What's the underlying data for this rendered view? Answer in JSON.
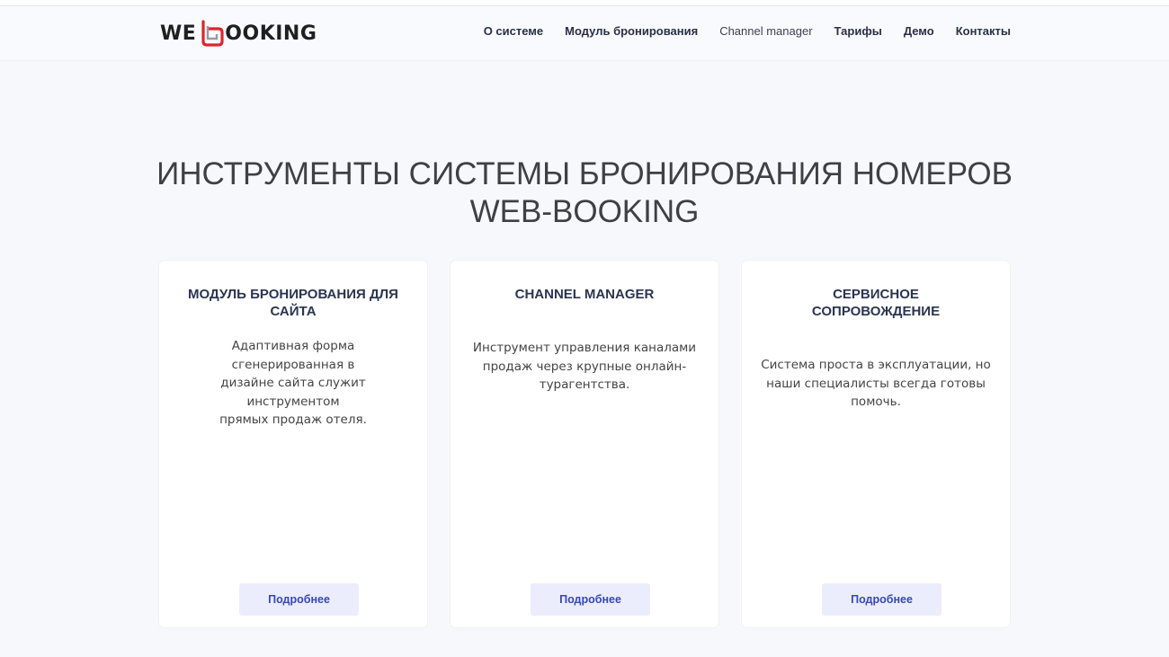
{
  "brand": {
    "logo_left": "WE",
    "logo_right": "OOKING",
    "accent_color": "#d8282e"
  },
  "nav": {
    "items": [
      {
        "label": "О системе"
      },
      {
        "label": "Модуль бронирования"
      },
      {
        "label": "Channel manager"
      },
      {
        "label": "Тарифы"
      },
      {
        "label": "Демо"
      },
      {
        "label": "Контакты"
      }
    ]
  },
  "hero": {
    "title_line1": "ИНСТРУМЕНТЫ СИСТЕМЫ БРОНИРОВАНИЯ НОМЕРОВ",
    "title_line2": "WEB-BOOKING"
  },
  "cards": [
    {
      "title_line1": "МОДУЛЬ БРОНИРОВАНИЯ ДЛЯ",
      "title_line2": "САЙТА",
      "text_line1": "Адаптивная форма сгенерированная в",
      "text_line2": "дизайне сайта служит инструментом",
      "text_line3": "прямых продаж отеля.",
      "button": "Подробнее"
    },
    {
      "title_line1": "CHANNEL MANAGER",
      "title_line2": "",
      "text_line1": "Инструмент управления каналами",
      "text_line2": "продаж через крупные онлайн-",
      "text_line3": "турагентства.",
      "button": "Подробнее"
    },
    {
      "title_line1": "СЕРВИСНОЕ",
      "title_line2": "СОПРОВОЖДЕНИЕ",
      "text_line1": "Система проста в эксплуатации, но",
      "text_line2": "наши специалисты всегда готовы",
      "text_line3": "помочь.",
      "button": "Подробнее"
    }
  ]
}
